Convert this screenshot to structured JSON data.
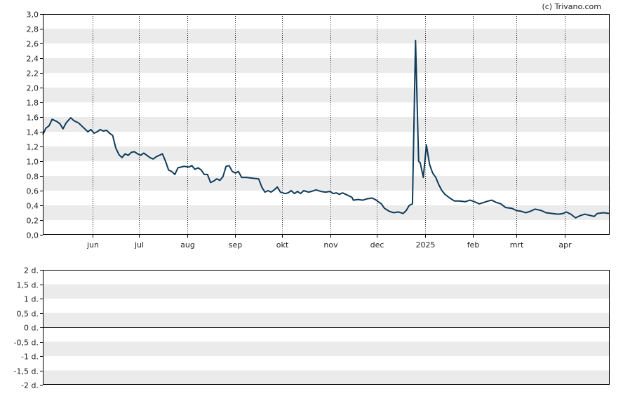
{
  "credit": "(c) Trivano.com",
  "colors": {
    "line": "#0e3b5c",
    "band": "#ebebeb",
    "grid": "#222222",
    "frame": "#000000"
  },
  "chart_data": [
    {
      "type": "line",
      "title": "",
      "xlabel": "",
      "ylabel": "",
      "ylim": [
        0,
        3.0
      ],
      "grid": "alternating horizontal bands, dotted vertical month lines",
      "y_ticks": [
        "0,0",
        "0,2",
        "0,4",
        "0,6",
        "0,8",
        "1,0",
        "1,2",
        "1,4",
        "1,6",
        "1,8",
        "2,0",
        "2,2",
        "2,4",
        "2,6",
        "2,8",
        "3,0"
      ],
      "y_tick_values": [
        0,
        0.2,
        0.4,
        0.6,
        0.8,
        1.0,
        1.2,
        1.4,
        1.6,
        1.8,
        2.0,
        2.2,
        2.4,
        2.6,
        2.8,
        3.0
      ],
      "x_range": [
        "2024-04-30",
        "2025-04-30"
      ],
      "x_ticks": [
        {
          "label": "jun",
          "date": "2024-06-01"
        },
        {
          "label": "jul",
          "date": "2024-07-01"
        },
        {
          "label": "aug",
          "date": "2024-08-01"
        },
        {
          "label": "sep",
          "date": "2024-09-01"
        },
        {
          "label": "okt",
          "date": "2024-10-01"
        },
        {
          "label": "nov",
          "date": "2024-11-01"
        },
        {
          "label": "dec",
          "date": "2024-12-01"
        },
        {
          "label": "2025",
          "date": "2025-01-01"
        },
        {
          "label": "feb",
          "date": "2025-02-01"
        },
        {
          "label": "mrt",
          "date": "2025-03-01"
        },
        {
          "label": "apr",
          "date": "2025-04-01"
        }
      ],
      "series": [
        {
          "points": [
            [
              "2024-04-30",
              1.36
            ],
            [
              "2024-05-02",
              1.45
            ],
            [
              "2024-05-04",
              1.48
            ],
            [
              "2024-05-06",
              1.57
            ],
            [
              "2024-05-09",
              1.54
            ],
            [
              "2024-05-11",
              1.51
            ],
            [
              "2024-05-13",
              1.44
            ],
            [
              "2024-05-15",
              1.52
            ],
            [
              "2024-05-18",
              1.59
            ],
            [
              "2024-05-20",
              1.55
            ],
            [
              "2024-05-23",
              1.52
            ],
            [
              "2024-05-26",
              1.46
            ],
            [
              "2024-05-29",
              1.4
            ],
            [
              "2024-05-31",
              1.43
            ],
            [
              "2024-06-02",
              1.38
            ],
            [
              "2024-06-04",
              1.4
            ],
            [
              "2024-06-06",
              1.43
            ],
            [
              "2024-06-08",
              1.41
            ],
            [
              "2024-06-10",
              1.42
            ],
            [
              "2024-06-12",
              1.38
            ],
            [
              "2024-06-14",
              1.35
            ],
            [
              "2024-06-16",
              1.18
            ],
            [
              "2024-06-18",
              1.09
            ],
            [
              "2024-06-20",
              1.05
            ],
            [
              "2024-06-22",
              1.1
            ],
            [
              "2024-06-24",
              1.08
            ],
            [
              "2024-06-26",
              1.12
            ],
            [
              "2024-06-28",
              1.13
            ],
            [
              "2024-06-30",
              1.1
            ],
            [
              "2024-07-02",
              1.08
            ],
            [
              "2024-07-04",
              1.11
            ],
            [
              "2024-07-06",
              1.08
            ],
            [
              "2024-07-08",
              1.05
            ],
            [
              "2024-07-10",
              1.03
            ],
            [
              "2024-07-12",
              1.06
            ],
            [
              "2024-07-14",
              1.08
            ],
            [
              "2024-07-16",
              1.1
            ],
            [
              "2024-07-18",
              1.0
            ],
            [
              "2024-07-20",
              0.88
            ],
            [
              "2024-07-22",
              0.86
            ],
            [
              "2024-07-24",
              0.82
            ],
            [
              "2024-07-26",
              0.91
            ],
            [
              "2024-07-28",
              0.92
            ],
            [
              "2024-07-30",
              0.93
            ],
            [
              "2024-08-02",
              0.92
            ],
            [
              "2024-08-04",
              0.94
            ],
            [
              "2024-08-06",
              0.89
            ],
            [
              "2024-08-08",
              0.91
            ],
            [
              "2024-08-10",
              0.88
            ],
            [
              "2024-08-12",
              0.82
            ],
            [
              "2024-08-14",
              0.82
            ],
            [
              "2024-08-16",
              0.71
            ],
            [
              "2024-08-18",
              0.73
            ],
            [
              "2024-08-20",
              0.76
            ],
            [
              "2024-08-22",
              0.74
            ],
            [
              "2024-08-24",
              0.79
            ],
            [
              "2024-08-26",
              0.93
            ],
            [
              "2024-08-28",
              0.94
            ],
            [
              "2024-08-30",
              0.86
            ],
            [
              "2024-09-01",
              0.84
            ],
            [
              "2024-09-03",
              0.86
            ],
            [
              "2024-09-05",
              0.78
            ],
            [
              "2024-09-08",
              0.78
            ],
            [
              "2024-09-12",
              0.77
            ],
            [
              "2024-09-16",
              0.76
            ],
            [
              "2024-09-18",
              0.65
            ],
            [
              "2024-09-20",
              0.58
            ],
            [
              "2024-09-22",
              0.6
            ],
            [
              "2024-09-24",
              0.58
            ],
            [
              "2024-09-26",
              0.61
            ],
            [
              "2024-09-28",
              0.65
            ],
            [
              "2024-09-30",
              0.58
            ],
            [
              "2024-10-03",
              0.56
            ],
            [
              "2024-10-05",
              0.57
            ],
            [
              "2024-10-07",
              0.6
            ],
            [
              "2024-10-09",
              0.56
            ],
            [
              "2024-10-11",
              0.59
            ],
            [
              "2024-10-13",
              0.56
            ],
            [
              "2024-10-15",
              0.6
            ],
            [
              "2024-10-18",
              0.58
            ],
            [
              "2024-10-20",
              0.59
            ],
            [
              "2024-10-23",
              0.61
            ],
            [
              "2024-10-26",
              0.59
            ],
            [
              "2024-10-29",
              0.58
            ],
            [
              "2024-11-01",
              0.59
            ],
            [
              "2024-11-03",
              0.56
            ],
            [
              "2024-11-05",
              0.57
            ],
            [
              "2024-11-07",
              0.55
            ],
            [
              "2024-11-09",
              0.57
            ],
            [
              "2024-11-12",
              0.54
            ],
            [
              "2024-11-15",
              0.51
            ],
            [
              "2024-11-16",
              0.47
            ],
            [
              "2024-11-19",
              0.48
            ],
            [
              "2024-11-22",
              0.47
            ],
            [
              "2024-11-25",
              0.49
            ],
            [
              "2024-11-28",
              0.5
            ],
            [
              "2024-11-30",
              0.48
            ],
            [
              "2024-12-02",
              0.45
            ],
            [
              "2024-12-04",
              0.42
            ],
            [
              "2024-12-06",
              0.36
            ],
            [
              "2024-12-09",
              0.32
            ],
            [
              "2024-12-12",
              0.3
            ],
            [
              "2024-12-15",
              0.31
            ],
            [
              "2024-12-18",
              0.29
            ],
            [
              "2024-12-20",
              0.33
            ],
            [
              "2024-12-22",
              0.4
            ],
            [
              "2024-12-24",
              0.42
            ],
            [
              "2024-12-26",
              2.64
            ],
            [
              "2024-12-28",
              1.0
            ],
            [
              "2024-12-29",
              0.98
            ],
            [
              "2024-12-31",
              0.78
            ],
            [
              "2025-01-02",
              1.22
            ],
            [
              "2025-01-04",
              0.96
            ],
            [
              "2025-01-06",
              0.84
            ],
            [
              "2025-01-08",
              0.78
            ],
            [
              "2025-01-10",
              0.68
            ],
            [
              "2025-01-12",
              0.6
            ],
            [
              "2025-01-14",
              0.55
            ],
            [
              "2025-01-17",
              0.5
            ],
            [
              "2025-01-20",
              0.46
            ],
            [
              "2025-01-23",
              0.46
            ],
            [
              "2025-01-27",
              0.45
            ],
            [
              "2025-01-30",
              0.47
            ],
            [
              "2025-02-02",
              0.45
            ],
            [
              "2025-02-05",
              0.42
            ],
            [
              "2025-02-08",
              0.44
            ],
            [
              "2025-02-11",
              0.46
            ],
            [
              "2025-02-13",
              0.47
            ],
            [
              "2025-02-16",
              0.44
            ],
            [
              "2025-02-19",
              0.42
            ],
            [
              "2025-02-22",
              0.37
            ],
            [
              "2025-02-26",
              0.36
            ],
            [
              "2025-03-01",
              0.33
            ],
            [
              "2025-03-04",
              0.32
            ],
            [
              "2025-03-07",
              0.3
            ],
            [
              "2025-03-10",
              0.32
            ],
            [
              "2025-03-13",
              0.35
            ],
            [
              "2025-03-17",
              0.33
            ],
            [
              "2025-03-20",
              0.3
            ],
            [
              "2025-03-24",
              0.29
            ],
            [
              "2025-03-28",
              0.28
            ],
            [
              "2025-03-31",
              0.29
            ],
            [
              "2025-04-02",
              0.31
            ],
            [
              "2025-04-05",
              0.28
            ],
            [
              "2025-04-08",
              0.23
            ],
            [
              "2025-04-11",
              0.26
            ],
            [
              "2025-04-14",
              0.28
            ],
            [
              "2025-04-18",
              0.26
            ],
            [
              "2025-04-20",
              0.25
            ],
            [
              "2025-04-22",
              0.29
            ],
            [
              "2025-04-26",
              0.3
            ],
            [
              "2025-04-30",
              0.29
            ]
          ]
        }
      ]
    },
    {
      "type": "line",
      "title": "",
      "xlabel": "",
      "ylabel": "",
      "ylim": [
        -2,
        2
      ],
      "y_ticks": [
        "2 d.",
        "1,5 d.",
        "1 d.",
        "0,5 d.",
        "0 d.",
        "-0,5 d.",
        "-1 d.",
        "-1,5 d.",
        "-2 d."
      ],
      "y_tick_values": [
        2,
        1.5,
        1,
        0.5,
        0,
        -0.5,
        -1,
        -1.5,
        -2
      ],
      "baseline": 0,
      "series": []
    }
  ]
}
